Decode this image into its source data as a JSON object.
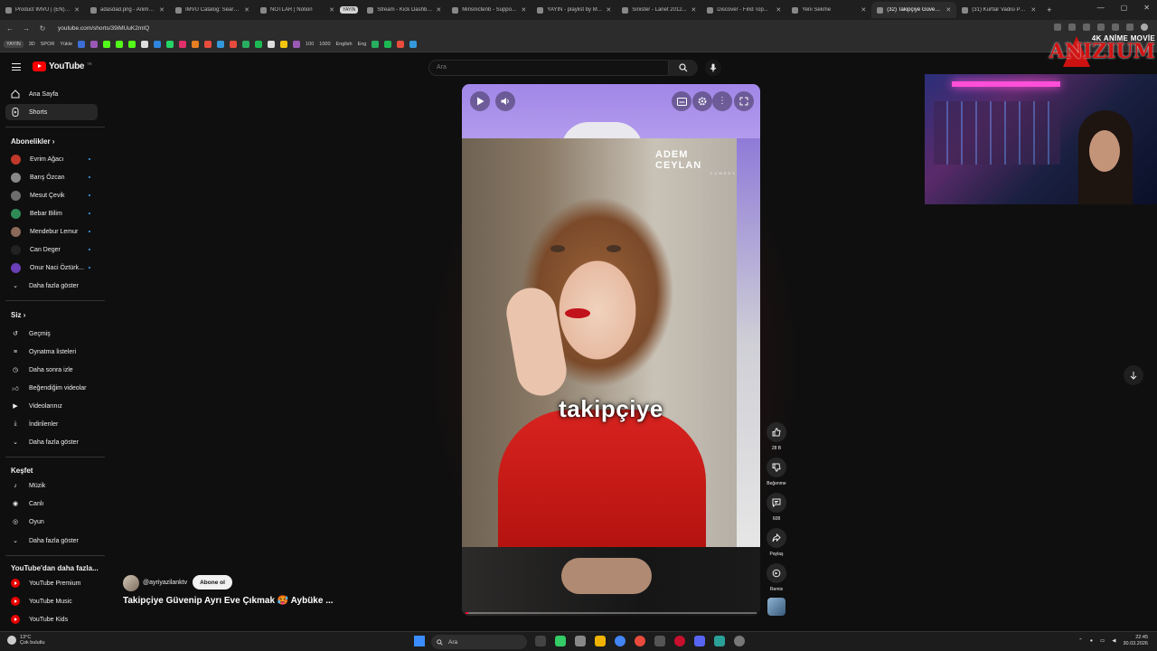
{
  "browser": {
    "tab_group": "YAYIN",
    "tabs": [
      {
        "title": "Product IMVU | (EN) ..."
      },
      {
        "title": "adasdad.png - Anima..."
      },
      {
        "title": "IMVU Catalog: Search..."
      },
      {
        "title": "NOTLAR | Notion"
      },
      {
        "title": "Stream - Kick Dashbo..."
      },
      {
        "title": "Minsnictenb - Suppo..."
      },
      {
        "title": "YAYIN - playlist by M..."
      },
      {
        "title": "Sinister - Lanet 2012..."
      },
      {
        "title": "Discover - Find Top..."
      },
      {
        "title": "Yeni Sekme"
      },
      {
        "title": "(32) Takipçiye Güveni..."
      },
      {
        "title": "(31) Kurtlar Vadisi Pu..."
      }
    ],
    "active_tab_index": 10,
    "url": "youtube.com/shorts/39iMUuK2mIQ",
    "bookmarks": [
      "YAYIN",
      "3D",
      "SPOR",
      "Yükle",
      "100",
      "1000",
      "English",
      "Eng"
    ]
  },
  "youtube": {
    "logo_text": "YouTube",
    "logo_country": "TR",
    "search_placeholder": "Ara",
    "nav": [
      {
        "label": "Ana Sayfa",
        "icon": "home-icon"
      },
      {
        "label": "Shorts",
        "icon": "shorts-icon"
      }
    ],
    "subscriptions_header": "Abonelikler",
    "subscriptions": [
      {
        "label": "Evrim Ağacı",
        "color": "#c0392b"
      },
      {
        "label": "Barış Özcan",
        "color": "#888888"
      },
      {
        "label": "Mesut Çevik",
        "color": "#6d6d6d"
      },
      {
        "label": "Bebar Bilim",
        "color": "#2e8b57"
      },
      {
        "label": "Mendebur Lemur",
        "color": "#8b6a5a"
      },
      {
        "label": "Can Deger",
        "color": "#222222"
      },
      {
        "label": "Onur Naci Öztürk...",
        "color": "#6a3fb5"
      }
    ],
    "show_more": "Daha fazla göster",
    "you_header": "Siz",
    "you_items": [
      {
        "label": "Geçmiş",
        "icon": "history-icon"
      },
      {
        "label": "Oynatma listeleri",
        "icon": "playlist-icon"
      },
      {
        "label": "Daha sonra izle",
        "icon": "clock-icon"
      },
      {
        "label": "Beğendiğim videolar",
        "icon": "thumbs-up-icon"
      },
      {
        "label": "Videolarınız",
        "icon": "video-icon"
      },
      {
        "label": "İndirilenler",
        "icon": "download-icon"
      }
    ],
    "explore_header": "Keşfet",
    "explore_items": [
      {
        "label": "Müzik",
        "icon": "music-icon"
      },
      {
        "label": "Canlı",
        "icon": "live-icon"
      },
      {
        "label": "Oyun",
        "icon": "gaming-icon"
      }
    ],
    "more_from_header": "YouTube'dan daha fazla...",
    "more_from_items": [
      {
        "label": "YouTube Premium"
      },
      {
        "label": "YouTube Music"
      },
      {
        "label": "YouTube Kids"
      }
    ]
  },
  "short": {
    "caption": "takipçiye",
    "watermark_main": "ADEM CEYLAN",
    "watermark_sub": "COMEDY",
    "channel_handle": "@ayriyazilanktv",
    "subscribe_label": "Abone ol",
    "title": "Takipçiye Güvenip Ayrı Eve Çıkmak 🥵 Aybüke ...",
    "likes": "28 B",
    "dislike_label": "Beğenme",
    "comments": "608",
    "share_label": "Paylaş",
    "remix_label": "Remix",
    "progress": 0.01
  },
  "overlay": {
    "brand_sub": "4K ANİME MOVİE",
    "brand_main": "ANIZIUM"
  },
  "taskbar": {
    "weather_temp": "13°C",
    "weather_desc": "Çok bulutlu",
    "search_label": "Ara",
    "time": "22:45",
    "date": "30.03.2026"
  },
  "colors": {
    "accent_red": "#ff0000",
    "background": "#0f0f0f",
    "dress_red": "#d8231f",
    "player_top": "#a186e8"
  }
}
